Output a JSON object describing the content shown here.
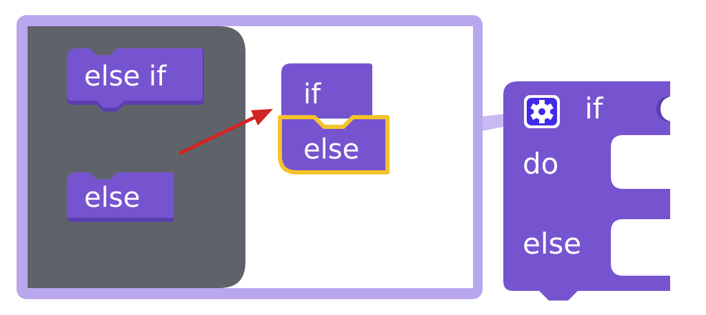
{
  "mutator_dialog": {
    "flyout_blocks": [
      {
        "label": "else if"
      },
      {
        "label": "else"
      }
    ],
    "workspace": {
      "if_label": "if",
      "else_label": "else"
    }
  },
  "main_block": {
    "if_label": "if",
    "do_label": "do",
    "else_label": "else",
    "mutator_icon": "gear-icon"
  },
  "colors": {
    "block_purple": "#7754cf",
    "block_dark_purple": "#5b3fb0",
    "dialog_border": "#b9a7ee",
    "flyout_bg": "#5f6369",
    "highlight": "#f4c32a",
    "arrow": "#d12424",
    "gear_bg": "#3f2be8"
  }
}
